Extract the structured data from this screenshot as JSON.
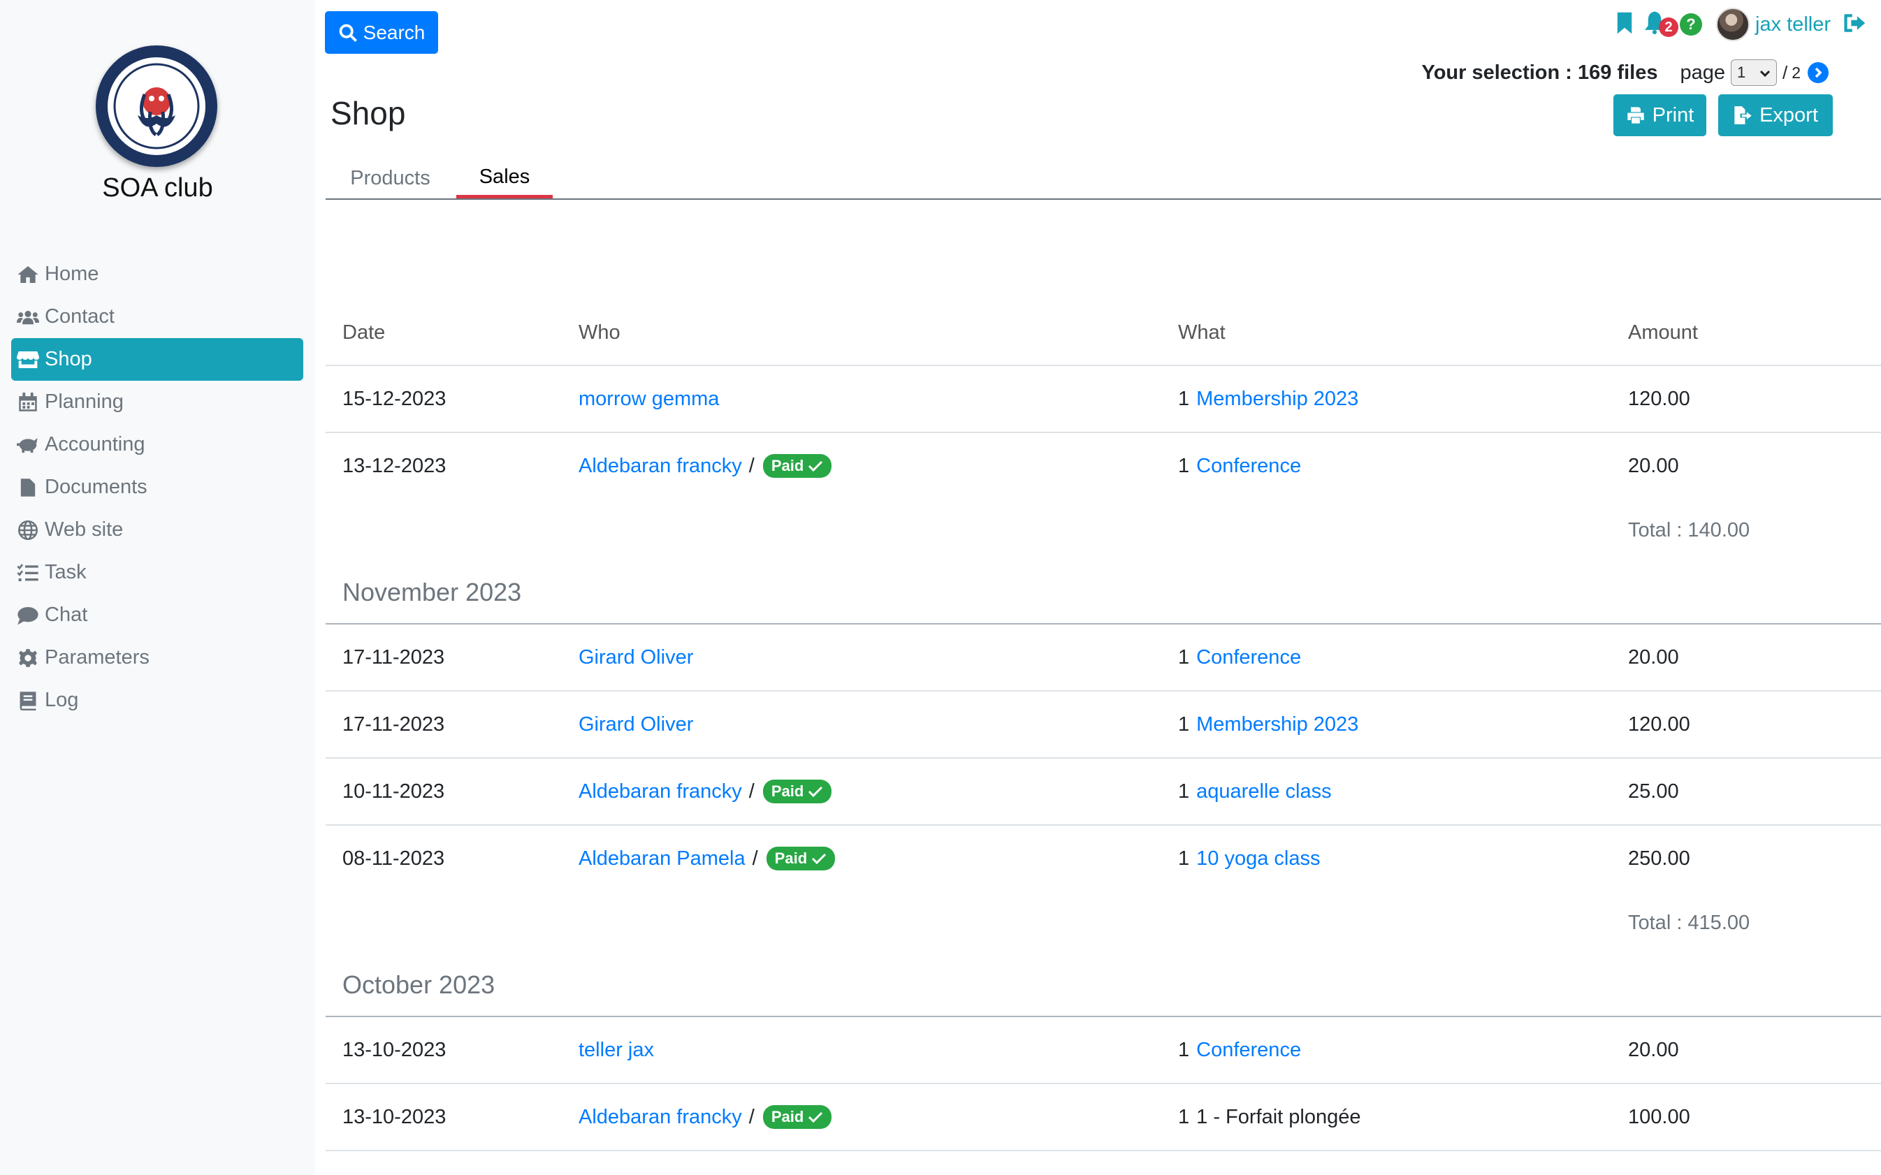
{
  "sidebar": {
    "brand": "SOA club",
    "items": [
      {
        "label": "Home",
        "icon": "home-icon"
      },
      {
        "label": "Contact",
        "icon": "users-icon"
      },
      {
        "label": "Shop",
        "icon": "store-icon",
        "active": true
      },
      {
        "label": "Planning",
        "icon": "calendar-icon"
      },
      {
        "label": "Accounting",
        "icon": "piggy-bank-icon"
      },
      {
        "label": "Documents",
        "icon": "file-icon"
      },
      {
        "label": "Web site",
        "icon": "globe-icon"
      },
      {
        "label": "Task",
        "icon": "list-check-icon"
      },
      {
        "label": "Chat",
        "icon": "comment-icon"
      },
      {
        "label": "Parameters",
        "icon": "gear-icon"
      },
      {
        "label": "Log",
        "icon": "book-icon"
      }
    ]
  },
  "header": {
    "search_label": "Search",
    "title": "Shop",
    "notification_count": "2",
    "help_label": "?",
    "username": "jax teller",
    "selection_text": "Your selection : 169 files",
    "page_label": "page",
    "current_page": "1",
    "page_separator": "/",
    "total_pages": "2",
    "print_label": "Print",
    "export_label": "Export"
  },
  "tabs": [
    {
      "label": "Products"
    },
    {
      "label": "Sales",
      "active": true
    }
  ],
  "table": {
    "columns": {
      "date": "Date",
      "who": "Who",
      "what": "What",
      "amount": "Amount"
    },
    "paid_label": "Paid",
    "who_separator": "/",
    "groups": [
      {
        "month": "",
        "total": "Total : 140.00",
        "rows": [
          {
            "date": "15-12-2023",
            "who": "morrow gemma",
            "paid": false,
            "qty": "1",
            "what": "Membership 2023",
            "what_link": true,
            "amount": "120.00"
          },
          {
            "date": "13-12-2023",
            "who": "Aldebaran francky",
            "paid": true,
            "qty": "1",
            "what": "Conference",
            "what_link": true,
            "amount": "20.00"
          }
        ]
      },
      {
        "month": "November 2023",
        "total": "Total : 415.00",
        "rows": [
          {
            "date": "17-11-2023",
            "who": "Girard Oliver",
            "paid": false,
            "qty": "1",
            "what": "Conference",
            "what_link": true,
            "amount": "20.00"
          },
          {
            "date": "17-11-2023",
            "who": "Girard Oliver",
            "paid": false,
            "qty": "1",
            "what": "Membership 2023",
            "what_link": true,
            "amount": "120.00"
          },
          {
            "date": "10-11-2023",
            "who": "Aldebaran francky",
            "paid": true,
            "qty": "1",
            "what": "aquarelle class",
            "what_link": true,
            "amount": "25.00"
          },
          {
            "date": "08-11-2023",
            "who": "Aldebaran Pamela",
            "paid": true,
            "qty": "1",
            "what": "10 yoga class",
            "what_link": true,
            "amount": "250.00"
          }
        ]
      },
      {
        "month": "October 2023",
        "total": "",
        "rows": [
          {
            "date": "13-10-2023",
            "who": "teller jax",
            "paid": false,
            "qty": "1",
            "what": "Conference",
            "what_link": true,
            "amount": "20.00"
          },
          {
            "date": "13-10-2023",
            "who": "Aldebaran francky",
            "paid": true,
            "qty": "1",
            "what": "1 - Forfait plongée",
            "what_link": false,
            "amount": "100.00"
          }
        ]
      }
    ]
  },
  "colors": {
    "accent_teal": "#17a2b8",
    "primary_blue": "#007bff",
    "paid_green": "#28a745",
    "tab_underline_red": "#dc3545"
  }
}
